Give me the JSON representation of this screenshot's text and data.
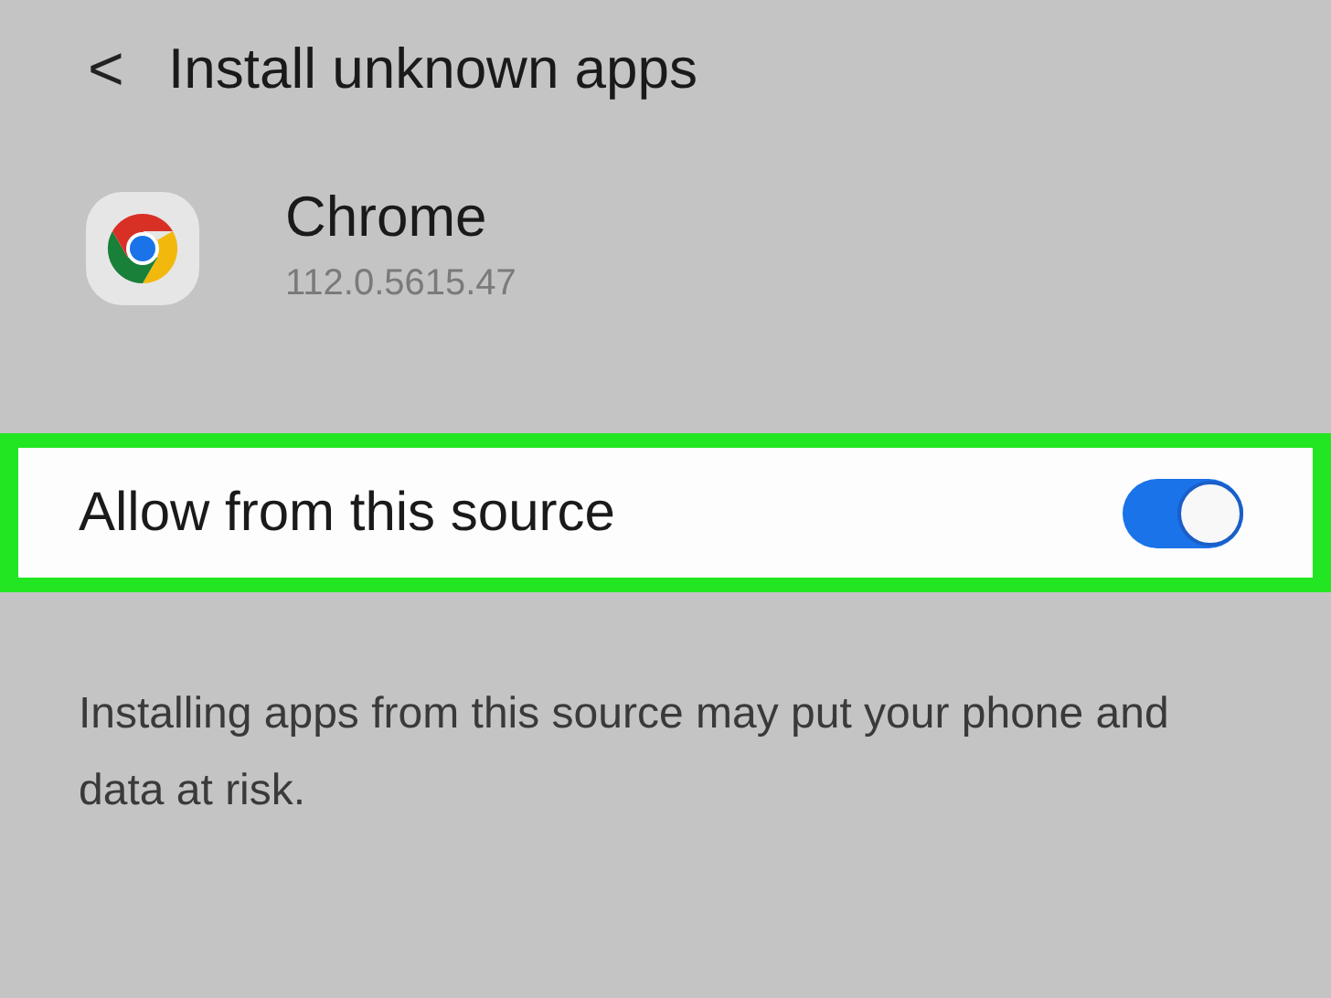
{
  "header": {
    "back_icon": "<",
    "title": "Install unknown apps"
  },
  "app": {
    "name": "Chrome",
    "version": "112.0.5615.47"
  },
  "setting": {
    "label": "Allow from this source",
    "on": true,
    "highlighted": true
  },
  "description": "Installing apps from this source may put your phone and data at risk."
}
